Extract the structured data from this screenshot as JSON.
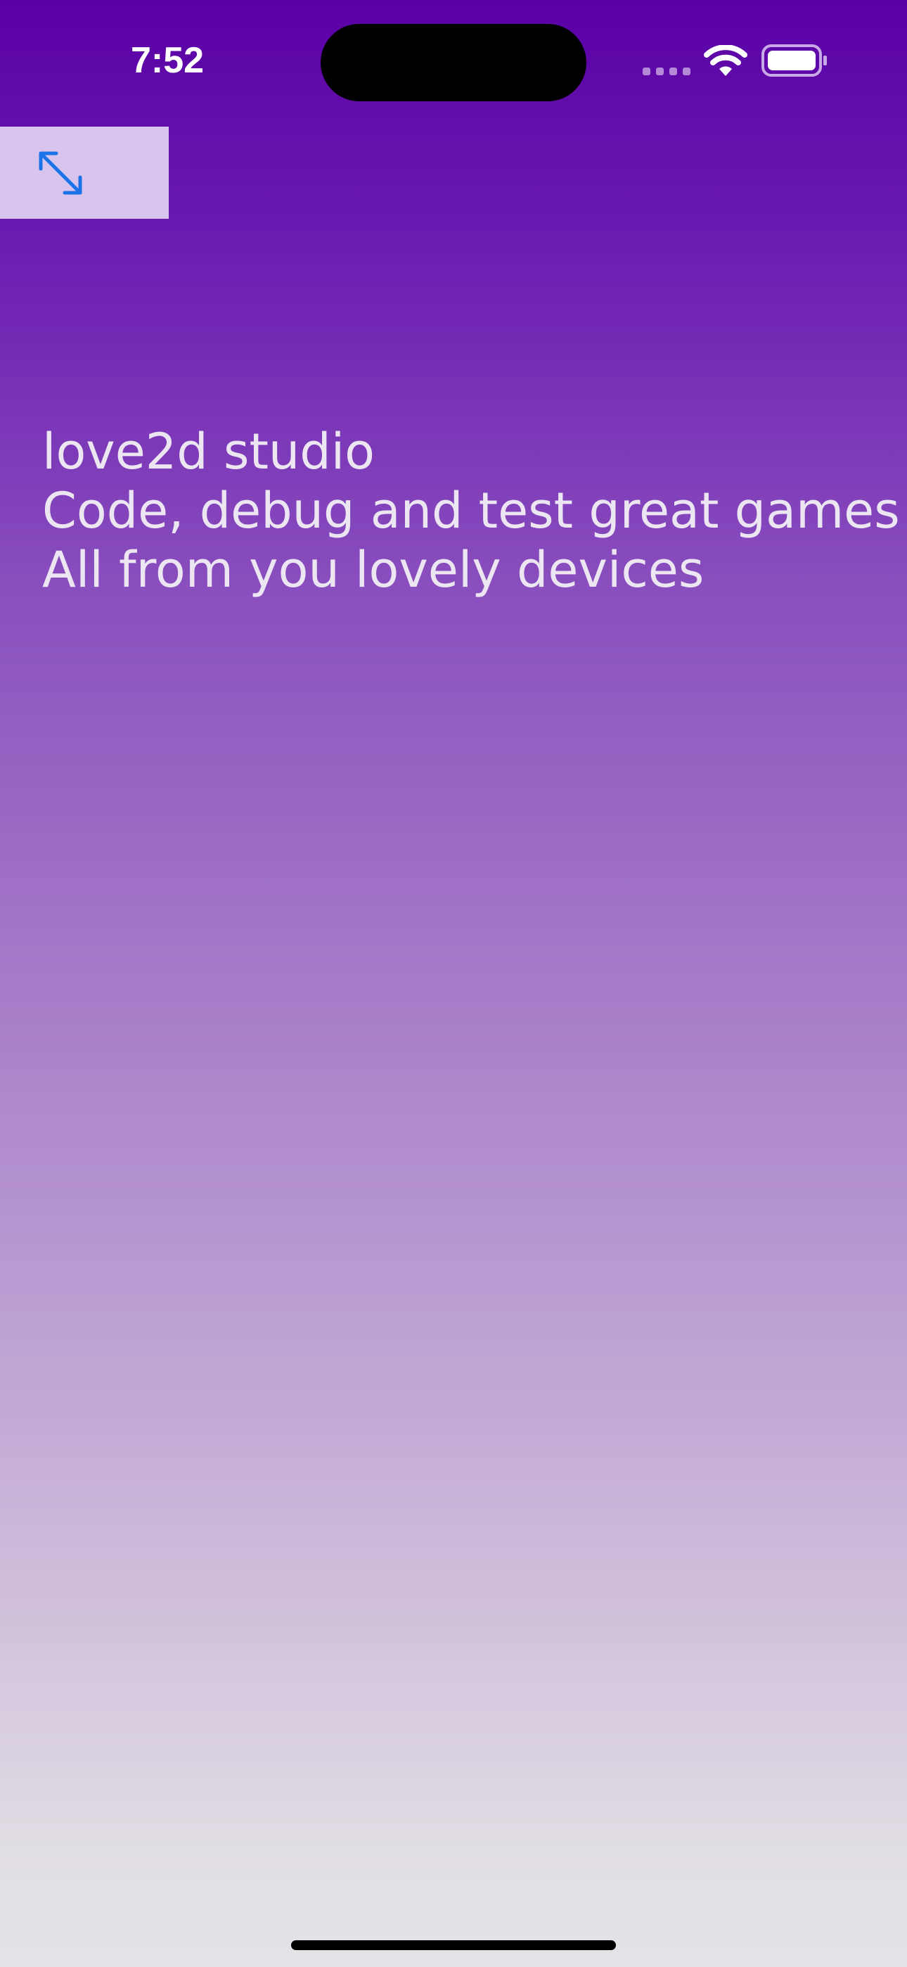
{
  "status_bar": {
    "time": "7:52",
    "icons": [
      "cellular-signal-icon",
      "wifi-icon",
      "battery-icon"
    ]
  },
  "toolbar": {
    "fullscreen_icon": "expand-arrows-icon",
    "accent_color": "#1a73e8"
  },
  "intro": {
    "title": "love2d studio",
    "line1": "Code, debug and test great games",
    "line2": "All from you lovely devices"
  },
  "colors": {
    "gradient_top": "#5a00a6",
    "gradient_bottom": "#e4e2e6",
    "text": "#ece6f2",
    "button_bg": "#d9c4ee"
  }
}
